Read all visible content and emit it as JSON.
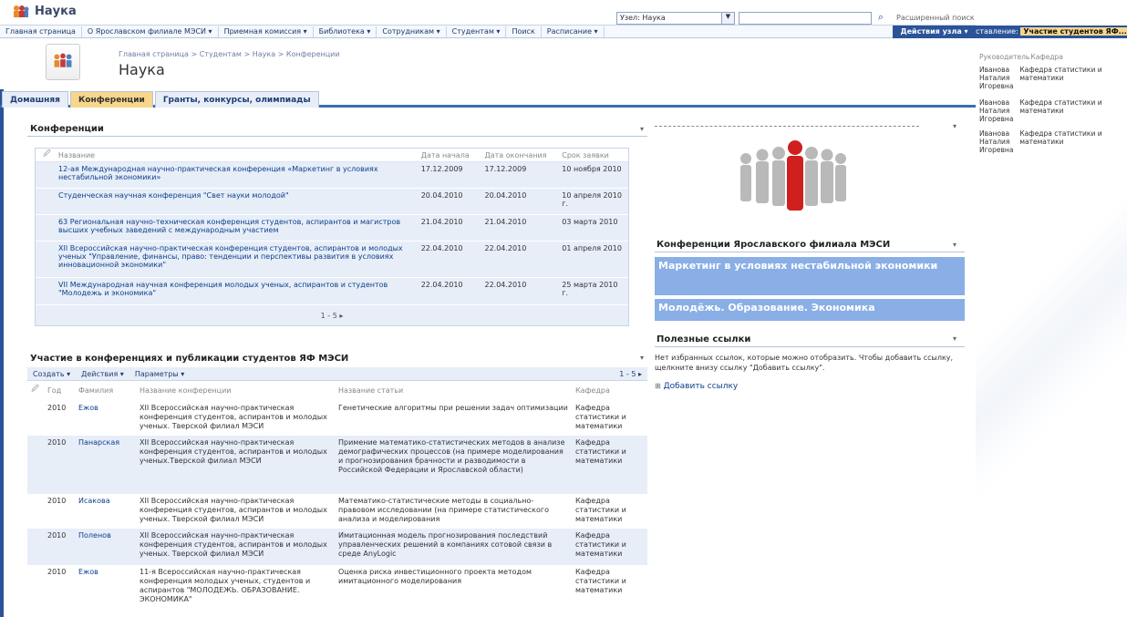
{
  "site": {
    "name": "Наука",
    "scope_value": "Узел: Наука",
    "advanced_search": "Расширенный поиск"
  },
  "nav": {
    "items": [
      "Главная страница",
      "О Ярославском филиале МЭСИ ▾",
      "Приемная комиссия ▾",
      "Библиотека ▾",
      "Сотрудникам ▾",
      "Студентам ▾",
      "Поиск",
      "Расписание ▾"
    ],
    "site_actions": "Действия узла ▾"
  },
  "page": {
    "breadcrumb": "Главная страница > Студентам > Наука > Конференции",
    "title": "Наука"
  },
  "tabs": [
    "Домашняя",
    "Конференции",
    "Гранты, конкурсы, олимпиады"
  ],
  "conferences": {
    "title": "Конференции",
    "headers": [
      "Название",
      "Дата начала",
      "Дата окончания",
      "Срок заявки"
    ],
    "rows": [
      [
        "12-ая Международная научно-практическая конференция «Маркетинг в условиях нестабильной экономики»",
        "17.12.2009",
        "17.12.2009",
        "10 ноября 2010"
      ],
      [
        "Студенческая научная конференция \"Свет науки молодой\"",
        "20.04.2010",
        "20.04.2010",
        "10 апреля 2010 г."
      ],
      [
        "63 Региональная научно-техническая конференция студентов, аспирантов и магистров высших учебных заведений с международным участием",
        "21.04.2010",
        "21.04.2010",
        "03 марта 2010"
      ],
      [
        "XII Всероссийская научно-практическая конференция студентов, аспирантов и молодых ученых \"Управление, финансы, право: тенденции и перспективы развития в условиях инновационной экономики\"",
        "22.04.2010",
        "22.04.2010",
        "01 апреля 2010"
      ],
      [
        "VII Международная научная конференция молодых ученых, аспирантов и студентов \"Молодежь и экономика\"",
        "22.04.2010",
        "22.04.2010",
        "25 марта 2010 г."
      ]
    ],
    "pager": "1 - 5 ▸"
  },
  "participation": {
    "title": "Участие в конференциях и публикации студентов ЯФ МЭСИ",
    "toolbar": [
      "Создать ▾",
      "Действия ▾",
      "Параметры ▾"
    ],
    "pager": "1 - 5 ▸",
    "headers": [
      "Год",
      "Фамилия",
      "Название конференции",
      "Название статьи",
      "Кафедра"
    ],
    "rows": [
      [
        "2010",
        "Ежов",
        "XII Всероссийская научно-практическая конференция студентов, аспирантов и молодых ученых. Тверской филиал МЭСИ",
        "Генетические алгоритмы при решении задач оптимизации",
        "Кафедра статистики и математики"
      ],
      [
        "2010",
        "Панарская",
        "XII Всероссийская научно-практическая конференция студентов, аспирантов и молодых ученых.Тверской филиал МЭСИ",
        "Примение математико-статистических методов в анализе демографических процессов (на примере моделирования и прогнозирования брачности и разводимости в Российской Федерации и Ярославской области)",
        "Кафедра статистики и математики"
      ],
      [
        "2010",
        "Исакова",
        "XII Всероссийская научно-практическая конференция студентов, аспирантов и молодых ученых. Тверской филиал МЭСИ",
        "Математико-статистические методы в социально-правовом исследовании (на примере статистического анализа и моделирования",
        "Кафедра статистики и математики"
      ],
      [
        "2010",
        "Поленов",
        "XII Всероссийская научно-практическая конференция студентов, аспирантов и молодых ученых. Тверской филиал МЭСИ",
        "Имитационная модель прогнозирования последствий управленческих решений в компаниях сотовой связи в среде AnyLogic",
        "Кафедра статистики и математики"
      ],
      [
        "2010",
        "Ежов",
        "11-я Всероссийская научно-практическая конференция молодых ученых, студентов и аспирантов \"МОЛОДЕЖЬ. ОБРАЗОВАНИЕ. ЭКОНОМИКА\"",
        "Оценка риска инвестиционного проекта методом имитационного моделирования",
        "Кафедра статистики и математики"
      ]
    ]
  },
  "right": {
    "conf_title": "Конференции Ярославского филиала МЭСИ",
    "conf_links": [
      "Маркетинг в условиях нестабильной экономики",
      "Молодёжь. Образование. Экономика"
    ],
    "useful_title": "Полезные ссылки",
    "useful_text": "Нет избранных ссылок, которые можно отобразить. Чтобы добавить ссылку, щелкните внизу ссылку \"Добавить ссылку\".",
    "add_link": "Добавить ссылку"
  },
  "side_panel": {
    "title_prefix": "ставление:",
    "title_bold": "Участие студентов ЯФ...",
    "headers": [
      "Руководитель",
      "Кафедра"
    ],
    "rows": [
      [
        "Иванова Наталия Игоревна",
        "Кафедра статистики и математики"
      ],
      [
        "Иванова Наталия Игоревна",
        "Кафедра статистики и математики"
      ],
      [
        "Иванова Наталия Игоревна",
        "Кафедра статистики и математики"
      ]
    ]
  }
}
